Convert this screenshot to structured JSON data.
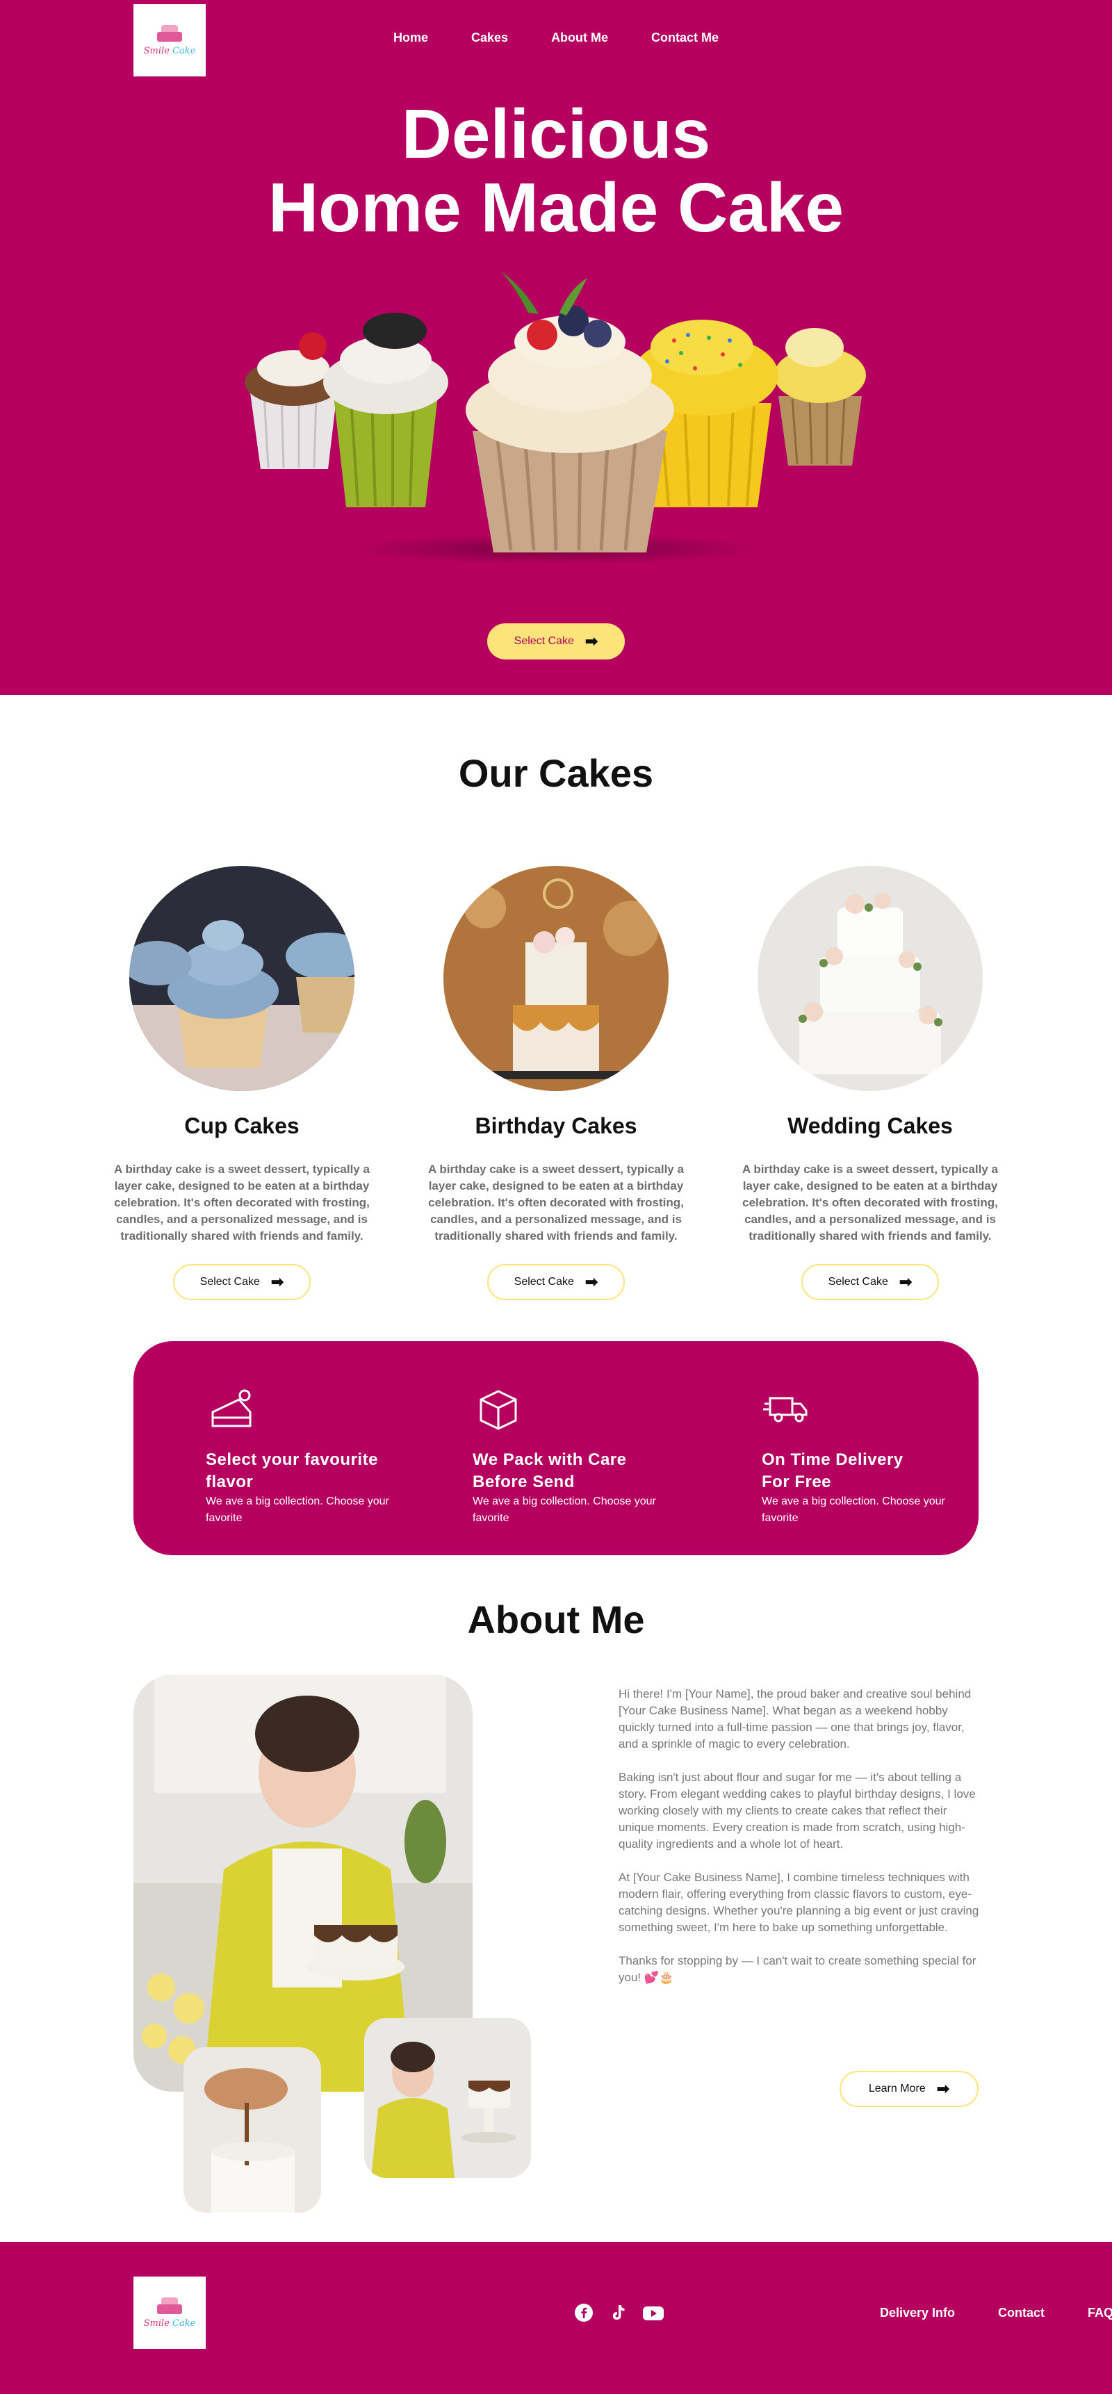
{
  "brand": {
    "logo_text_a": "Smile",
    "logo_text_b": "Cake"
  },
  "nav": {
    "items": [
      "Home",
      "Cakes",
      "About Me",
      "Contact Me"
    ]
  },
  "hero": {
    "title_line1": "Delicious",
    "title_line2": "Home Made Cake",
    "cta_label": "Select Cake"
  },
  "cakes": {
    "title": "Our Cakes",
    "items": [
      {
        "name": "Cup Cakes",
        "description": "A birthday cake is a sweet dessert, typically a layer cake, designed to be eaten at a birthday celebration. It's often decorated with frosting, candles, and a personalized message, and is traditionally shared with friends and family.",
        "button": "Select Cake"
      },
      {
        "name": "Birthday Cakes",
        "description": "A birthday cake is a sweet dessert, typically a layer cake, designed to be eaten at a birthday celebration. It's often decorated with frosting, candles, and a personalized message, and is traditionally shared with friends and family.",
        "button": "Select Cake"
      },
      {
        "name": "Wedding Cakes",
        "description": "A birthday cake is a sweet dessert, typically a layer cake, designed to be eaten at a birthday celebration. It's often decorated with frosting, candles, and a personalized message, and is traditionally shared with friends and family.",
        "button": "Select Cake"
      }
    ]
  },
  "features": [
    {
      "icon": "cake-slice-icon",
      "title_line1": "Select your favourite",
      "title_line2": "flavor",
      "text": "We ave a big collection. Choose your favorite"
    },
    {
      "icon": "box-icon",
      "title_line1": "We Pack with Care",
      "title_line2": "Before Send",
      "text": "We ave a big collection. Choose your favorite"
    },
    {
      "icon": "delivery-truck-icon",
      "title_line1": "On Time Delivery",
      "title_line2": "For Free",
      "text": "We ave a big collection. Choose your favorite"
    }
  ],
  "about": {
    "title": "About Me",
    "paragraphs": [
      "Hi there! I'm [Your Name], the proud baker and creative soul behind [Your Cake Business Name]. What began as a weekend hobby quickly turned into a full-time passion — one that brings joy, flavor, and a sprinkle of magic to every celebration.",
      "Baking isn't just about flour and sugar for me — it's about telling a story. From elegant wedding cakes to playful birthday designs, I love working closely with my clients to create cakes that reflect their unique moments. Every creation is made from scratch, using high-quality ingredients and a whole lot of heart.",
      "At [Your Cake Business Name], I combine timeless techniques with modern flair, offering everything from classic flavors to custom, eye-catching designs. Whether you're planning a big event or just craving something sweet, I'm here to bake up something unforgettable.",
      "Thanks for stopping by — I can't wait to create something special for you! 💕🎂"
    ],
    "button": "Learn More"
  },
  "footer": {
    "social": [
      "facebook-icon",
      "tiktok-icon",
      "youtube-icon"
    ],
    "links": [
      "Delivery Info",
      "Contact",
      "FAQ"
    ]
  },
  "colors": {
    "brand": "#b5005f",
    "accent": "#fde47a"
  }
}
